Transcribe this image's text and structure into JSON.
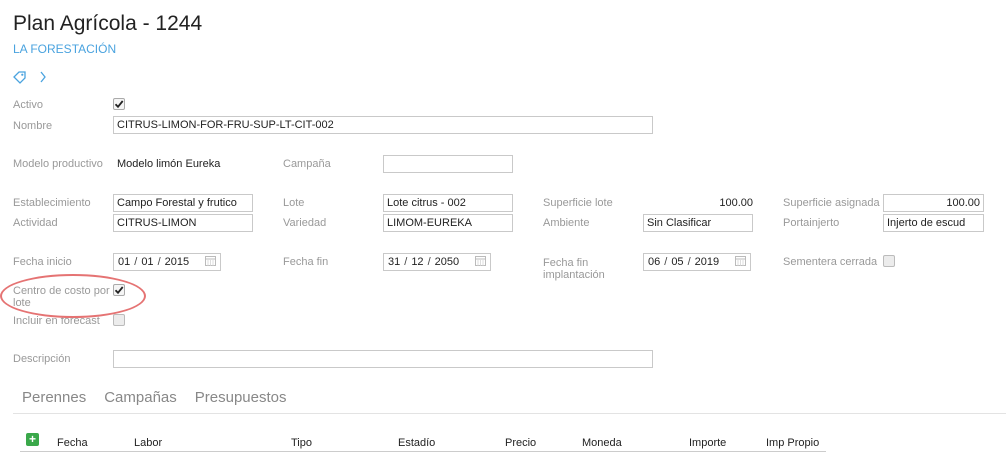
{
  "header": {
    "title": "Plan Agrícola - 1244",
    "subtitle": "LA FORESTACIÓN",
    "tag_icon": "tag-icon",
    "chevron_icon": "chevron-right-icon"
  },
  "form": {
    "activo_label": "Activo",
    "activo_checked": true,
    "nombre_label": "Nombre",
    "nombre_value": "CITRUS-LIMON-FOR-FRU-SUP-LT-CIT-002",
    "modelo_label": "Modelo productivo",
    "modelo_value": "Modelo limón Eureka",
    "campana_label": "Campaña",
    "campana_value": "",
    "establecimiento_label": "Establecimiento",
    "establecimiento_value": "Campo Forestal y frutico",
    "lote_label": "Lote",
    "lote_value": "Lote citrus - 002",
    "superficie_lote_label": "Superficie lote",
    "superficie_lote_value": "100.00",
    "superficie_asignada_label": "Superficie asignada",
    "superficie_asignada_value": "100.00",
    "actividad_label": "Actividad",
    "actividad_value": "CITRUS-LIMON",
    "variedad_label": "Variedad",
    "variedad_value": "LIMOM-EUREKA",
    "ambiente_label": "Ambiente",
    "ambiente_value": "Sin Clasificar",
    "portainjerto_label": "Portainjerto",
    "portainjerto_value": "Injerto de escud",
    "fecha_inicio_label": "Fecha inicio",
    "fecha_inicio": {
      "d": "01",
      "m": "01",
      "y": "2015"
    },
    "fecha_fin_label": "Fecha fin",
    "fecha_fin": {
      "d": "31",
      "m": "12",
      "y": "2050"
    },
    "fecha_fin_impl_label": "Fecha fin implantación",
    "fecha_fin_impl": {
      "d": "06",
      "m": "05",
      "y": "2019"
    },
    "sementera_label": "Sementera cerrada",
    "sementera_checked": false,
    "centro_costo_label": "Centro de costo por lote",
    "centro_costo_checked": true,
    "incluir_forecast_label": "Incluir en forecast",
    "incluir_forecast_checked": false,
    "descripcion_label": "Descripción",
    "descripcion_value": "",
    "date_sep": "/"
  },
  "tabs": [
    "Perennes",
    "Campañas",
    "Presupuestos"
  ],
  "grid": {
    "add_label": "+",
    "columns": [
      "Fecha",
      "Labor",
      "Tipo",
      "Estadío",
      "Precio",
      "Moneda",
      "Importe",
      "Imp Propio"
    ]
  },
  "colors": {
    "accent": "#4aa3df",
    "highlight": "#e57373",
    "add_button": "#3aa84a"
  }
}
